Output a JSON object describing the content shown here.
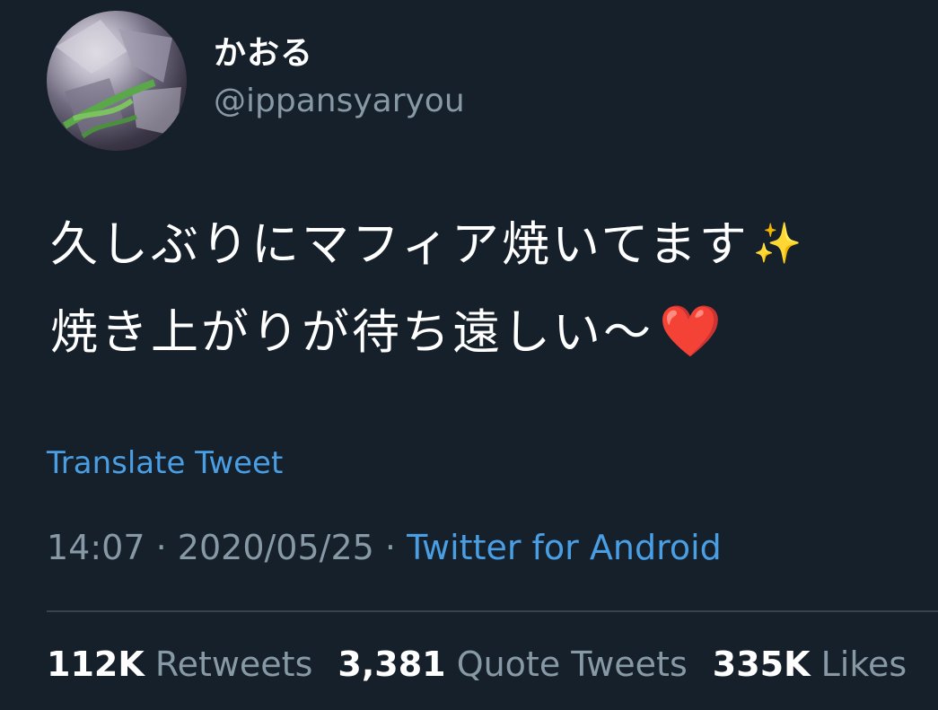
{
  "user": {
    "display_name": "かおる",
    "handle": "@ippansyaryou"
  },
  "tweet": {
    "line1": "久しぶりにマフィア焼いてます",
    "line1_emoji": "✨",
    "line2": "焼き上がりが待ち遠しい〜",
    "line2_emoji": "❤️",
    "translate_label": "Translate Tweet",
    "time": "14:07",
    "date": "2020/05/25",
    "separator": "·",
    "source": "Twitter for Android"
  },
  "stats": {
    "retweets_count": "112K",
    "retweets_label": "Retweets",
    "quotes_count": "3,381",
    "quotes_label": "Quote Tweets",
    "likes_count": "335K",
    "likes_label": "Likes"
  },
  "colors": {
    "background": "#15202b",
    "link": "#4a9ee3",
    "secondary_text": "#8899a6"
  }
}
